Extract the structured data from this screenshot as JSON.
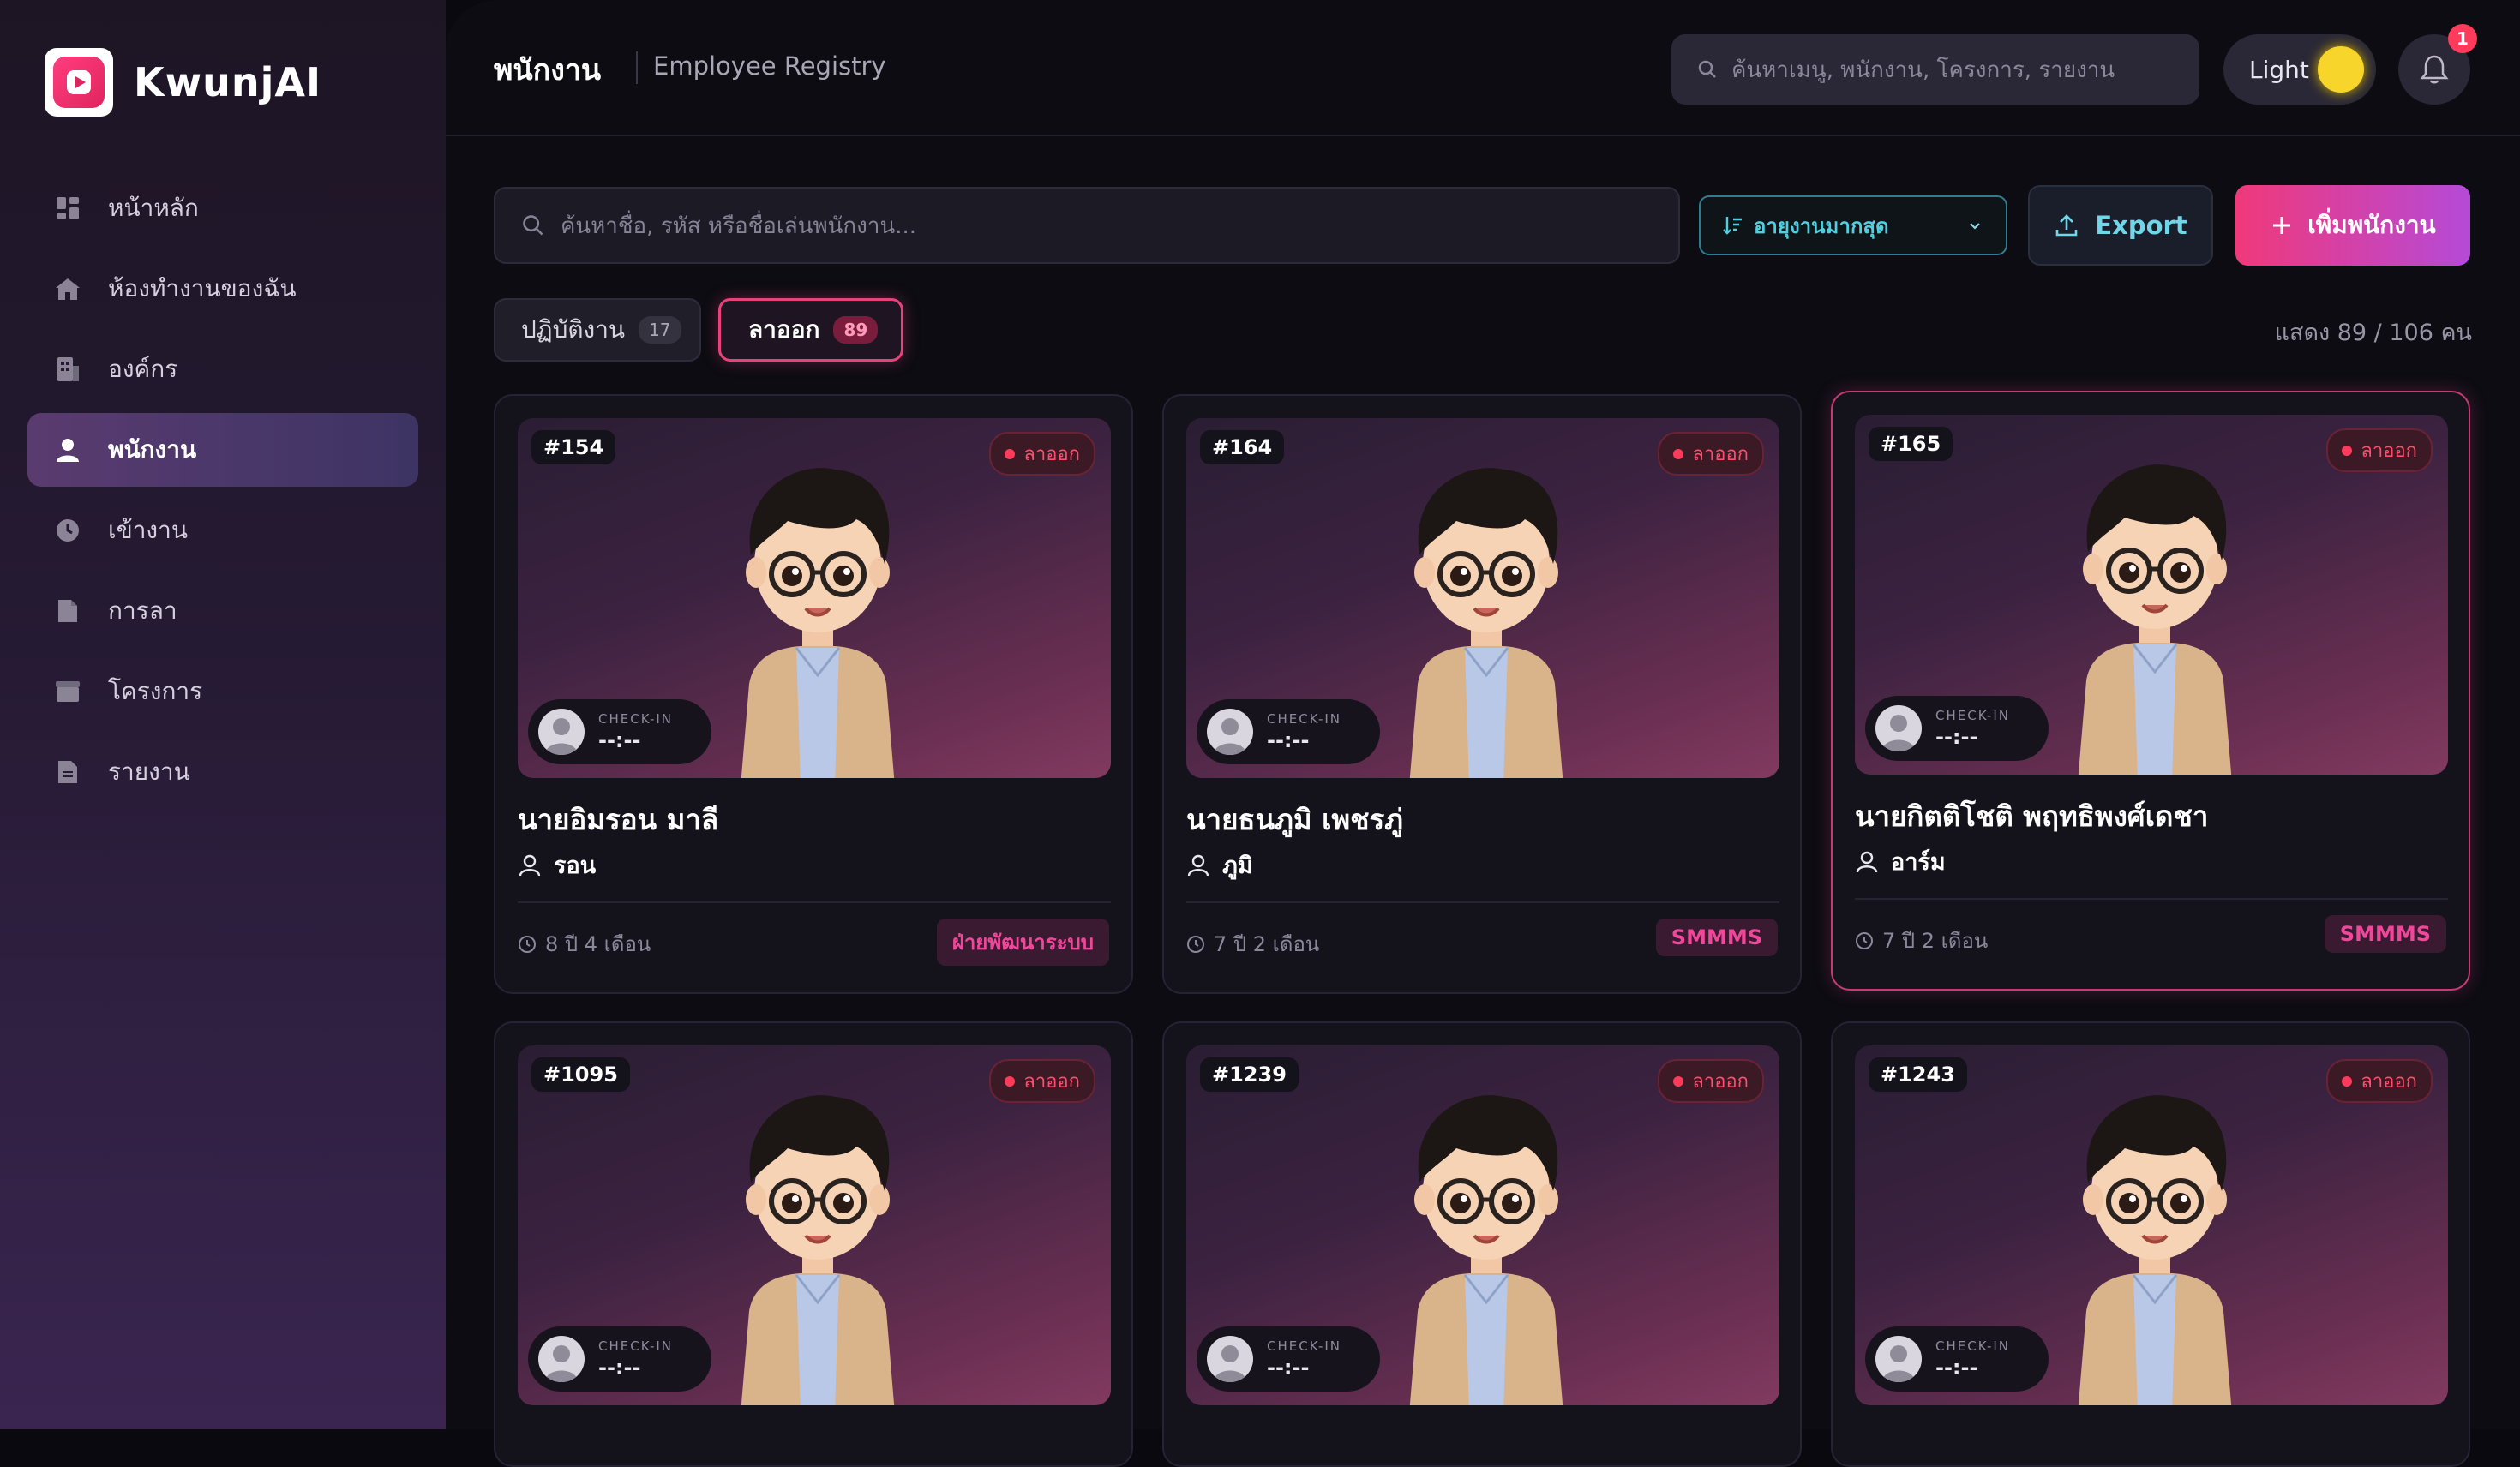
{
  "app": {
    "name": "KwunjAI"
  },
  "sidebar": {
    "items": [
      {
        "label": "หน้าหลัก",
        "icon": "dashboard-icon"
      },
      {
        "label": "ห้องทำงานของฉัน",
        "icon": "home-icon"
      },
      {
        "label": "องค์กร",
        "icon": "building-icon"
      },
      {
        "label": "พนักงาน",
        "icon": "user-icon",
        "active": true
      },
      {
        "label": "เข้างาน",
        "icon": "clock-icon"
      },
      {
        "label": "การลา",
        "icon": "document-icon"
      },
      {
        "label": "โครงการ",
        "icon": "folder-icon"
      },
      {
        "label": "รายงาน",
        "icon": "report-icon"
      }
    ]
  },
  "header": {
    "title": "พนักงาน",
    "subtitle": "Employee Registry",
    "search_placeholder": "ค้นหาเมนู, พนักงาน, โครงการ, รายงาน",
    "theme_label": "Light",
    "notification_count": "1"
  },
  "toolbar": {
    "search_placeholder": "ค้นหาชื่อ, รหัส หรือชื่อเล่นพนักงาน...",
    "sort_label": "อายุงานมากสุด",
    "export_label": "Export",
    "add_label": "เพิ่มพนักงาน"
  },
  "tabs": [
    {
      "label": "ปฏิบัติงาน",
      "count": "17"
    },
    {
      "label": "ลาออก",
      "count": "89",
      "active": true
    }
  ],
  "showing_text": "แสดง 89 / 106 คน",
  "cards": [
    {
      "id": "#154",
      "status": "ลาออก",
      "checkin_label": "CHECK-IN",
      "checkin_value": "--:--",
      "name": "นายอิมรอน มาลี",
      "nickname": "รอน",
      "tenure": "8 ปี 4 เดือน",
      "dept": "ฝ่ายพัฒนาระบบ"
    },
    {
      "id": "#164",
      "status": "ลาออก",
      "checkin_label": "CHECK-IN",
      "checkin_value": "--:--",
      "name": "นายธนภูมิ เพชรภู่",
      "nickname": "ภูมิ",
      "tenure": "7 ปี 2 เดือน",
      "dept": "SMMMS"
    },
    {
      "id": "#165",
      "status": "ลาออก",
      "checkin_label": "CHECK-IN",
      "checkin_value": "--:--",
      "name": "นายกิตติโชติ พฤทธิพงศ์เดชา",
      "nickname": "อาร์ม",
      "tenure": "7 ปี 2 เดือน",
      "dept": "SMMMS"
    },
    {
      "id": "#1095",
      "status": "ลาออก",
      "checkin_label": "CHECK-IN",
      "checkin_value": "--:--"
    },
    {
      "id": "#1239",
      "status": "ลาออก",
      "checkin_label": "CHECK-IN",
      "checkin_value": "--:--"
    },
    {
      "id": "#1243",
      "status": "ลาออก",
      "checkin_label": "CHECK-IN",
      "checkin_value": "--:--"
    }
  ],
  "colors": {
    "accent_pink": "#f0397a",
    "accent_cyan": "#4fd0e0",
    "status_red": "#ff3b5c"
  }
}
